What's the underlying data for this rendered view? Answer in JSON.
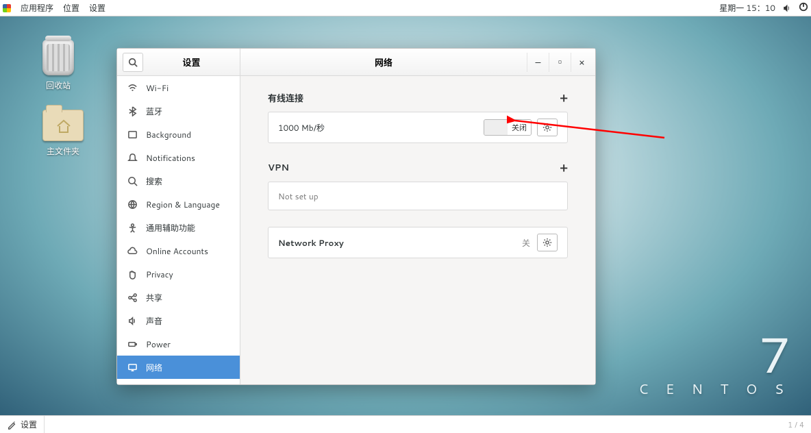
{
  "menubar": {
    "apps": "应用程序",
    "places": "位置",
    "settings": "设置",
    "clock": "星期一 15：10"
  },
  "desktop": {
    "trash_label": "回收站",
    "home_label": "主文件夹"
  },
  "window": {
    "left_title": "设置",
    "center_title": "网络"
  },
  "sidebar": {
    "items": [
      {
        "label": "Wi-Fi"
      },
      {
        "label": "蓝牙"
      },
      {
        "label": "Background"
      },
      {
        "label": "Notifications"
      },
      {
        "label": "搜索"
      },
      {
        "label": "Region & Language"
      },
      {
        "label": "通用辅助功能"
      },
      {
        "label": "Online Accounts"
      },
      {
        "label": "Privacy"
      },
      {
        "label": "共享"
      },
      {
        "label": "声音"
      },
      {
        "label": "Power"
      },
      {
        "label": "网络"
      }
    ]
  },
  "content": {
    "wired_title": "有线连接",
    "add": "+",
    "wired_speed": "1000 Mb/秒",
    "switch_off_label": "关闭",
    "vpn_title": "VPN",
    "vpn_status": "Not set up",
    "proxy_label": "Network Proxy",
    "proxy_state": "关"
  },
  "taskbar": {
    "item1": "设置",
    "right_hint": "1 / 4"
  },
  "brand": {
    "big": "7",
    "sub": "C E N T O S"
  }
}
